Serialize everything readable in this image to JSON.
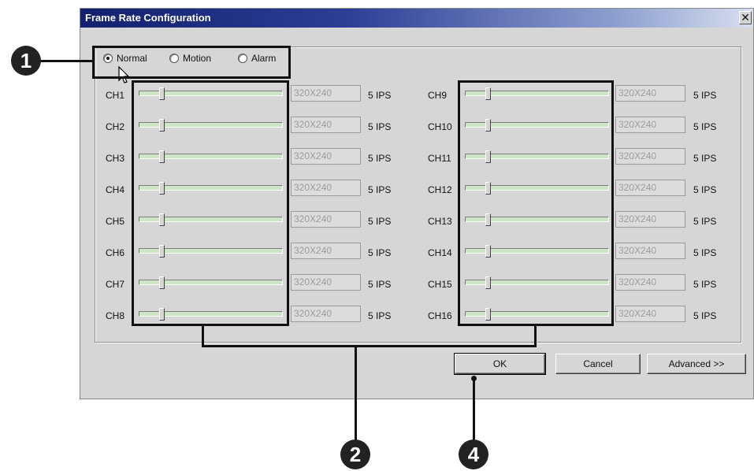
{
  "dialog": {
    "title": "Frame Rate Configuration",
    "close_glyph": "✕"
  },
  "modes": [
    {
      "label": "Normal",
      "checked": true
    },
    {
      "label": "Motion",
      "checked": false
    },
    {
      "label": "Alarm",
      "checked": false
    }
  ],
  "channels": [
    {
      "label": "CH1",
      "resolution": "320X240",
      "rate": "5 IPS",
      "slider_level": 0.15
    },
    {
      "label": "CH2",
      "resolution": "320X240",
      "rate": "5 IPS",
      "slider_level": 0.15
    },
    {
      "label": "CH3",
      "resolution": "320X240",
      "rate": "5 IPS",
      "slider_level": 0.15
    },
    {
      "label": "CH4",
      "resolution": "320X240",
      "rate": "5 IPS",
      "slider_level": 0.15
    },
    {
      "label": "CH5",
      "resolution": "320X240",
      "rate": "5 IPS",
      "slider_level": 0.15
    },
    {
      "label": "CH6",
      "resolution": "320X240",
      "rate": "5 IPS",
      "slider_level": 0.15
    },
    {
      "label": "CH7",
      "resolution": "320X240",
      "rate": "5 IPS",
      "slider_level": 0.15
    },
    {
      "label": "CH8",
      "resolution": "320X240",
      "rate": "5 IPS",
      "slider_level": 0.15
    },
    {
      "label": "CH9",
      "resolution": "320X240",
      "rate": "5 IPS",
      "slider_level": 0.15
    },
    {
      "label": "CH10",
      "resolution": "320X240",
      "rate": "5 IPS",
      "slider_level": 0.15
    },
    {
      "label": "CH11",
      "resolution": "320X240",
      "rate": "5 IPS",
      "slider_level": 0.15
    },
    {
      "label": "CH12",
      "resolution": "320X240",
      "rate": "5 IPS",
      "slider_level": 0.15
    },
    {
      "label": "CH13",
      "resolution": "320X240",
      "rate": "5 IPS",
      "slider_level": 0.15
    },
    {
      "label": "CH14",
      "resolution": "320X240",
      "rate": "5 IPS",
      "slider_level": 0.15
    },
    {
      "label": "CH15",
      "resolution": "320X240",
      "rate": "5 IPS",
      "slider_level": 0.15
    },
    {
      "label": "CH16",
      "resolution": "320X240",
      "rate": "5 IPS",
      "slider_level": 0.15
    }
  ],
  "buttons": {
    "ok": "OK",
    "cancel": "Cancel",
    "advanced": "Advanced >>"
  },
  "callouts": [
    "1",
    "2",
    "4"
  ],
  "colors": {
    "title_gradient_start": "#12206e",
    "slider_track": "#cfe6c6",
    "dialog_bg": "#d6d6d6"
  }
}
